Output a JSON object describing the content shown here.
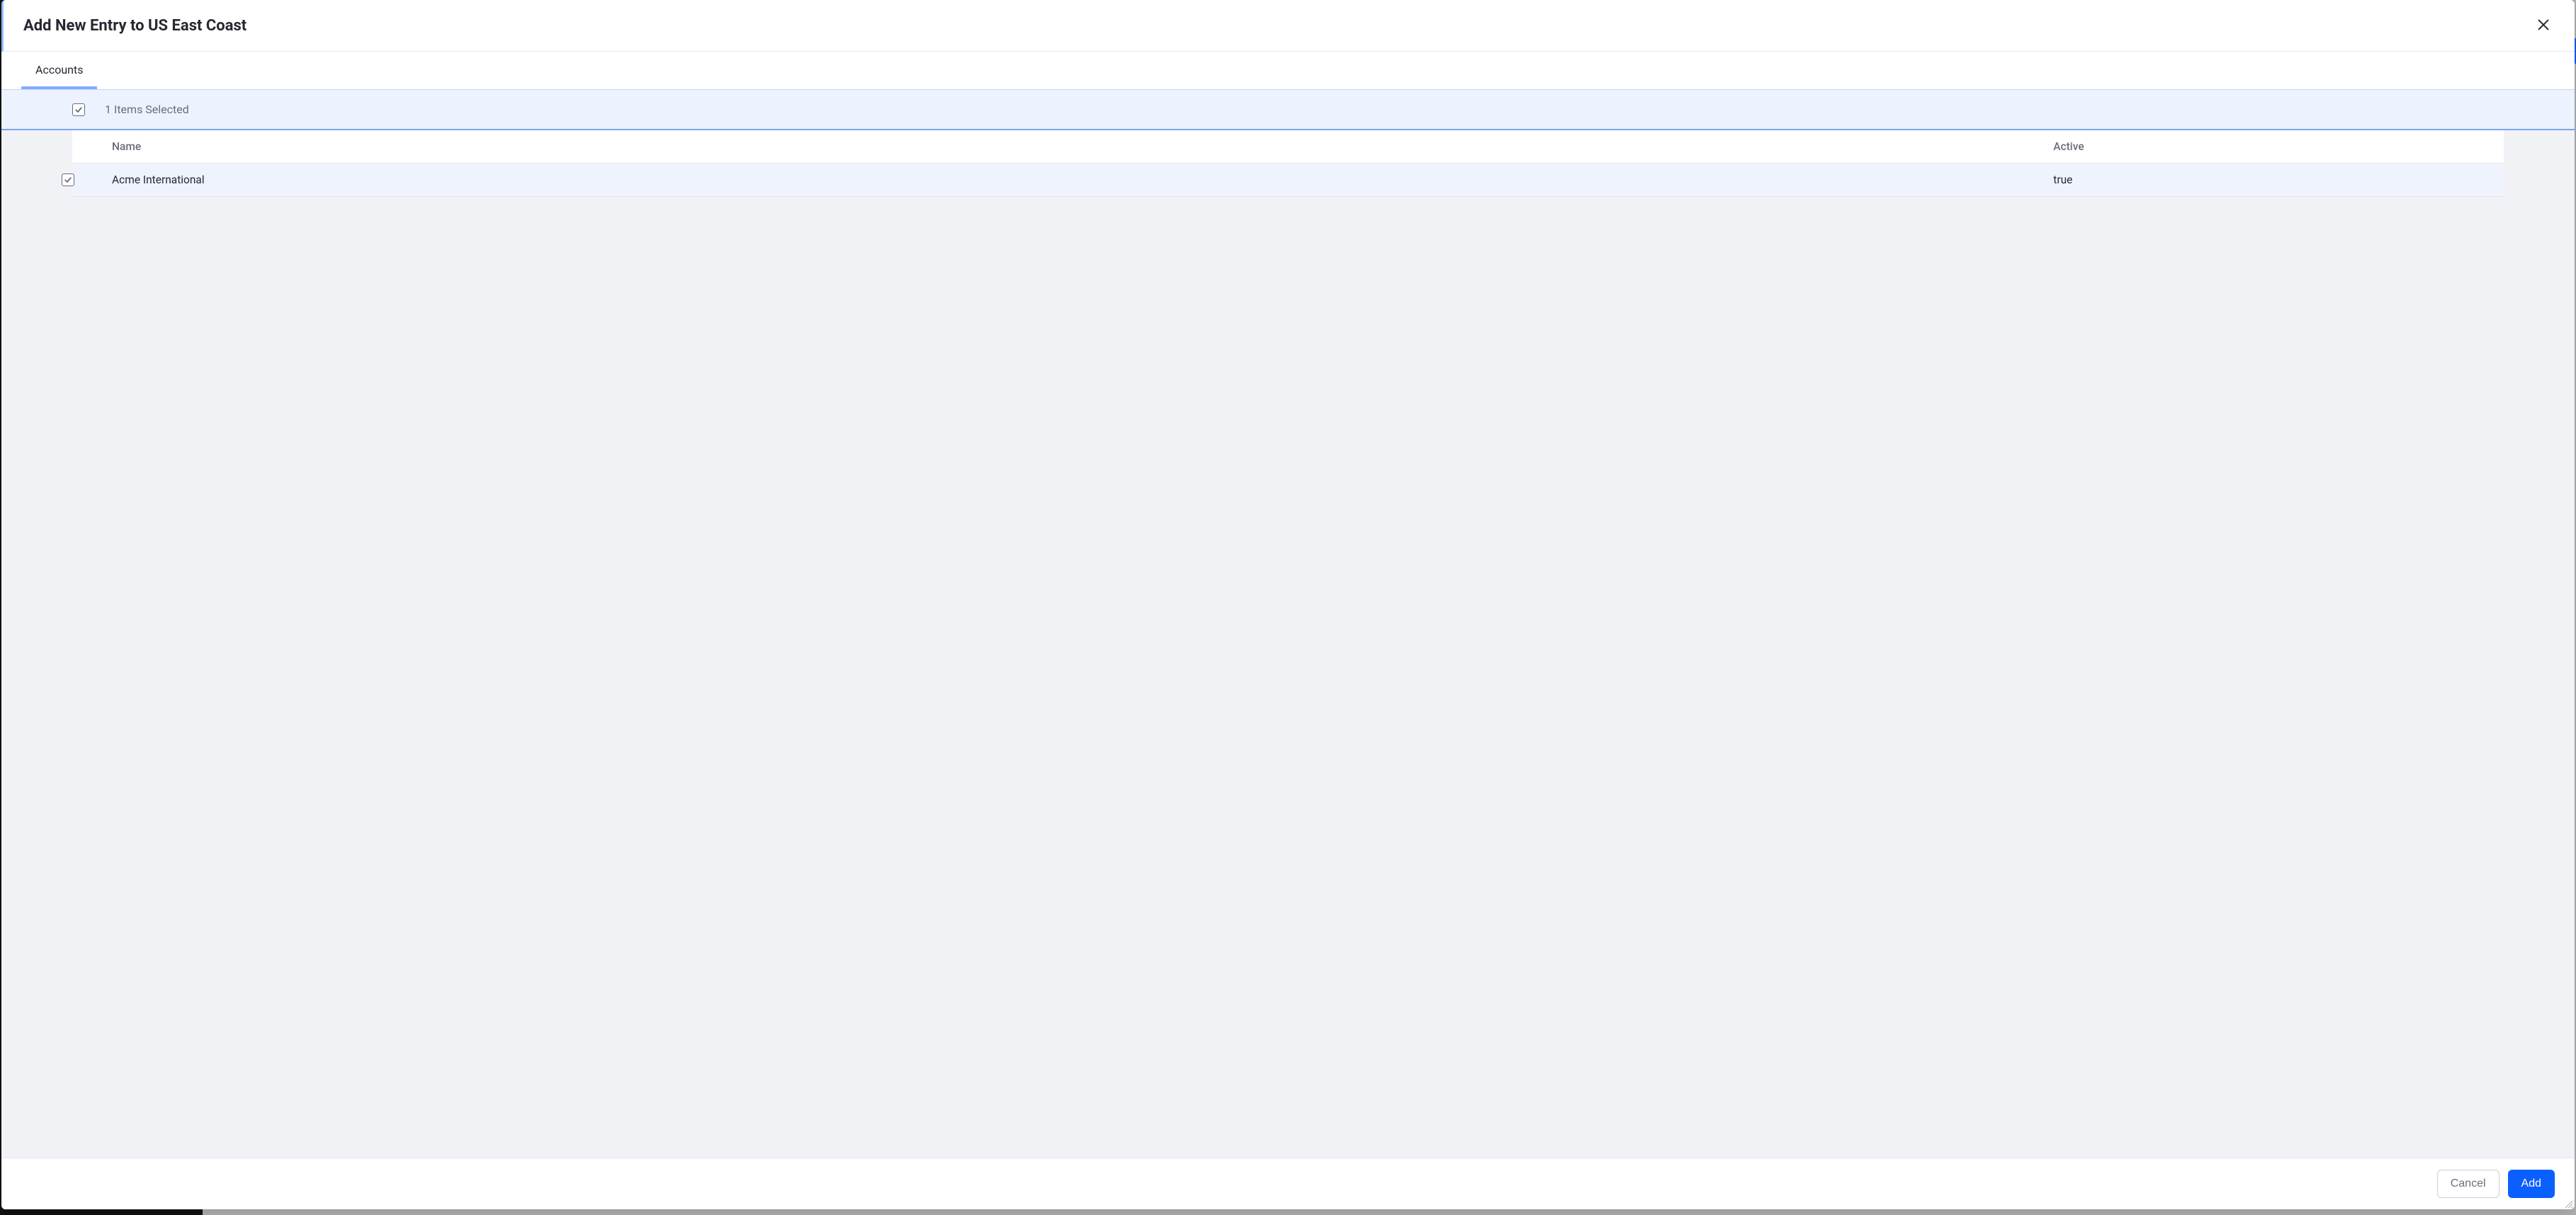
{
  "dialog": {
    "title": "Add New Entry to US East Coast"
  },
  "tabs": [
    {
      "label": "Accounts",
      "active": true
    }
  ],
  "selection": {
    "text": "1 Items Selected"
  },
  "table": {
    "headers": {
      "name": "Name",
      "active": "Active"
    },
    "rows": [
      {
        "name": "Acme International",
        "active": "true",
        "checked": true
      }
    ]
  },
  "footer": {
    "cancel": "Cancel",
    "add": "Add"
  }
}
